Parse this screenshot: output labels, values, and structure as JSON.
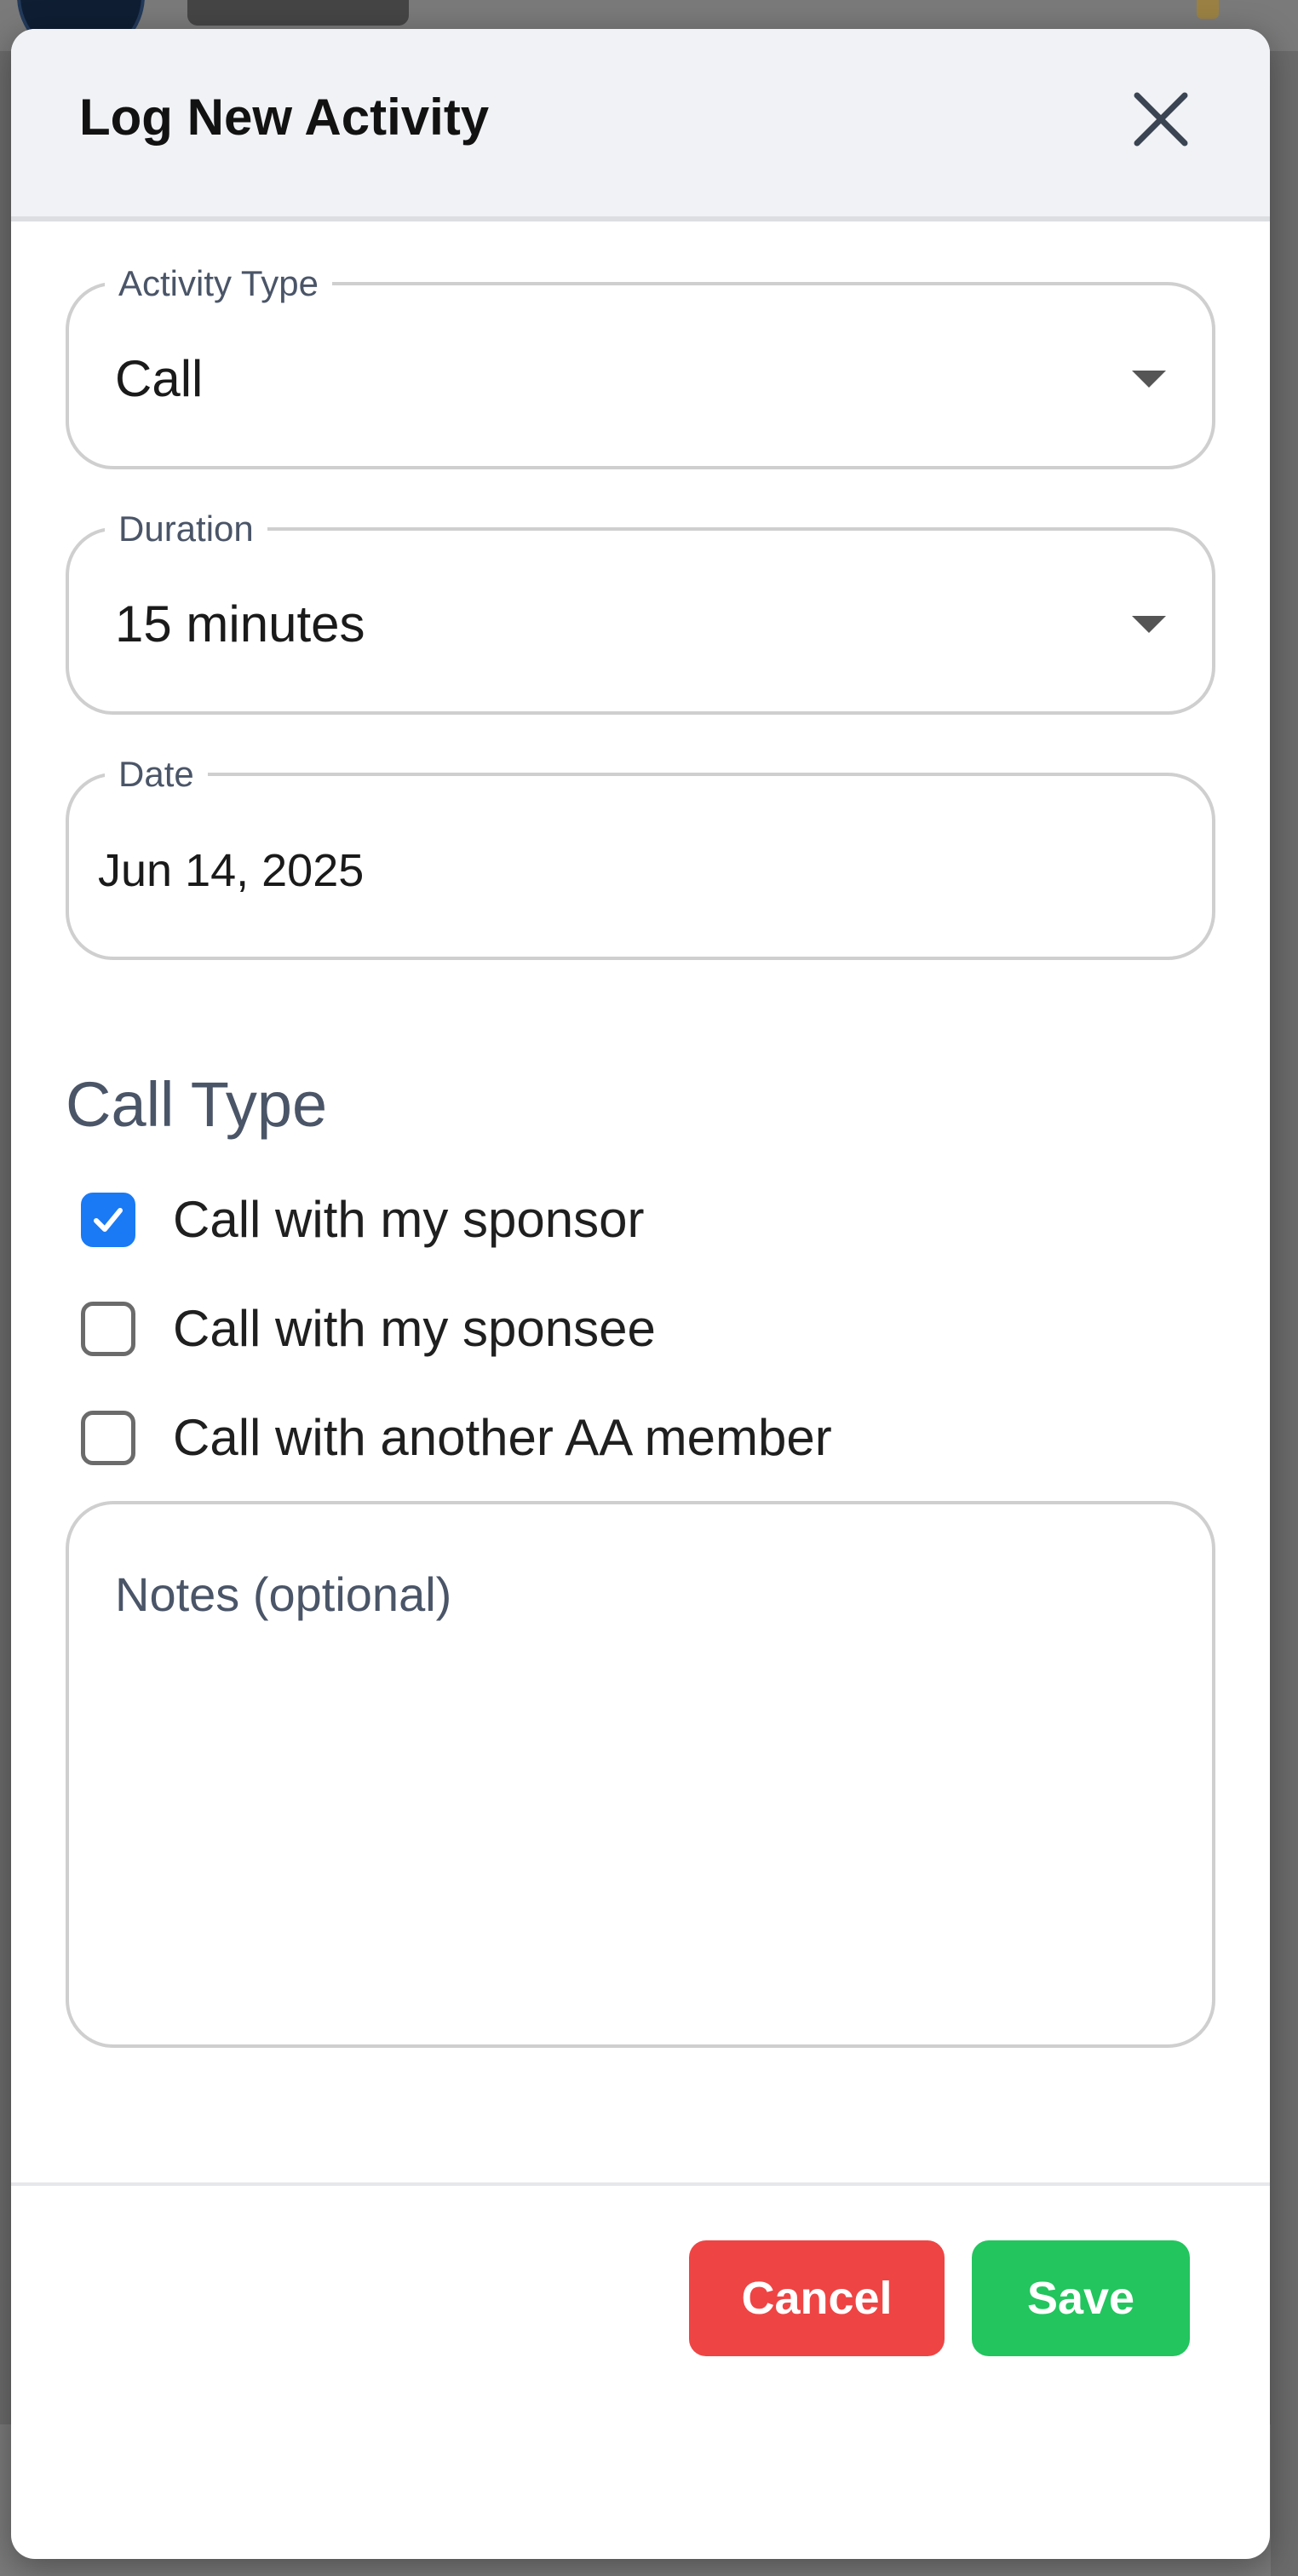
{
  "modal": {
    "title": "Log New Activity",
    "close_icon": "close-icon"
  },
  "fields": {
    "activity_type": {
      "label": "Activity Type",
      "value": "Call"
    },
    "duration": {
      "label": "Duration",
      "value": "15 minutes"
    },
    "date": {
      "label": "Date",
      "value": "Jun 14, 2025"
    }
  },
  "call_type": {
    "title": "Call Type",
    "options": [
      {
        "label": "Call with my sponsor",
        "checked": true
      },
      {
        "label": "Call with my sponsee",
        "checked": false
      },
      {
        "label": "Call with another AA member",
        "checked": false
      }
    ]
  },
  "notes": {
    "placeholder": "Notes (optional)",
    "value": ""
  },
  "footer": {
    "cancel_label": "Cancel",
    "save_label": "Save"
  },
  "colors": {
    "cancel": "#ef4444",
    "save": "#22c55e",
    "checkbox_checked": "#1a7af5",
    "header_bg": "#f1f2f5"
  }
}
